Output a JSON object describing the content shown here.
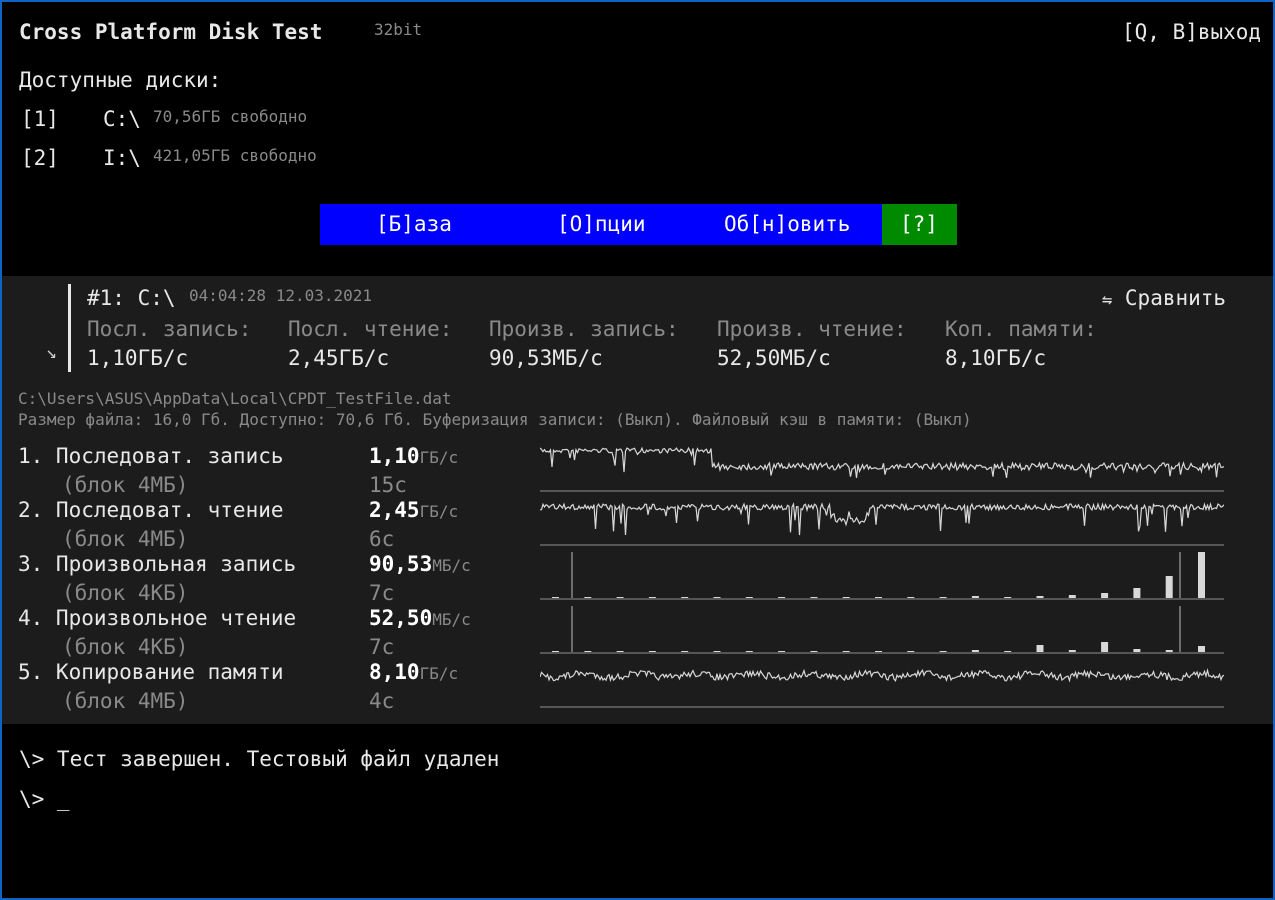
{
  "header": {
    "title": "Cross Platform Disk Test",
    "arch": "32bit",
    "exit_label": "[Q, B]выход"
  },
  "drives": {
    "heading": "Доступные диски:",
    "items": [
      {
        "key": "[1]",
        "path": "C:\\",
        "free": "70,56ГБ свободно"
      },
      {
        "key": "[2]",
        "path": "I:\\",
        "free": "421,05ГБ свободно"
      }
    ]
  },
  "menu": {
    "items": [
      "[Б]аза",
      "[О]пции",
      "Об[н]овить"
    ],
    "help": "[?]"
  },
  "result": {
    "id": "#1: C:\\",
    "timestamp": "04:04:28 12.03.2021",
    "compare_label": "Сравнить",
    "compare_icon": "swap-arrows-icon",
    "collapse_icon": "arrow-down-right-icon",
    "columns": [
      {
        "label": "Посл. запись:",
        "value": "1,10ГБ/с"
      },
      {
        "label": "Посл. чтение:",
        "value": "2,45ГБ/с"
      },
      {
        "label": "Произв. запись:",
        "value": "90,53МБ/с"
      },
      {
        "label": "Произв. чтение:",
        "value": "52,50МБ/с"
      },
      {
        "label": "Коп. памяти:",
        "value": "8,10ГБ/с"
      }
    ]
  },
  "file_info": {
    "path": "C:\\Users\\ASUS\\AppData\\Local\\CPDT_TestFile.dat",
    "details": "Размер файла: 16,0 Гб. Доступно: 70,6 Гб. Буферизация записи: (Выкл). Файловый кэш в памяти: (Выкл)"
  },
  "tests": [
    {
      "name": "1. Последоват. запись",
      "block": "(блок 4МБ)",
      "value": "1,10",
      "unit": "ГБ/с",
      "time": "15с"
    },
    {
      "name": "2. Последоват. чтение",
      "block": "(блок 4МБ)",
      "value": "2,45",
      "unit": "ГБ/с",
      "time": "6с"
    },
    {
      "name": "3. Произвольная запись",
      "block": "(блок 4КБ)",
      "value": "90,53",
      "unit": "МБ/с",
      "time": "7с"
    },
    {
      "name": "4. Произвольное чтение",
      "block": "(блок 4КБ)",
      "value": "52,50",
      "unit": "МБ/с",
      "time": "7с"
    },
    {
      "name": "5. Копирование памяти",
      "block": "(блок 4МБ)",
      "value": "8,10",
      "unit": "ГБ/с",
      "time": "4с"
    }
  ],
  "console": {
    "lines": [
      "\\> Тест завершен. Тестовый файл удален",
      "\\> _"
    ]
  },
  "colors": {
    "menu_bg": "#0000ff",
    "help_bg": "#008a00",
    "window_border": "#0f64c4",
    "panel_bg": "#1c1c1c"
  }
}
